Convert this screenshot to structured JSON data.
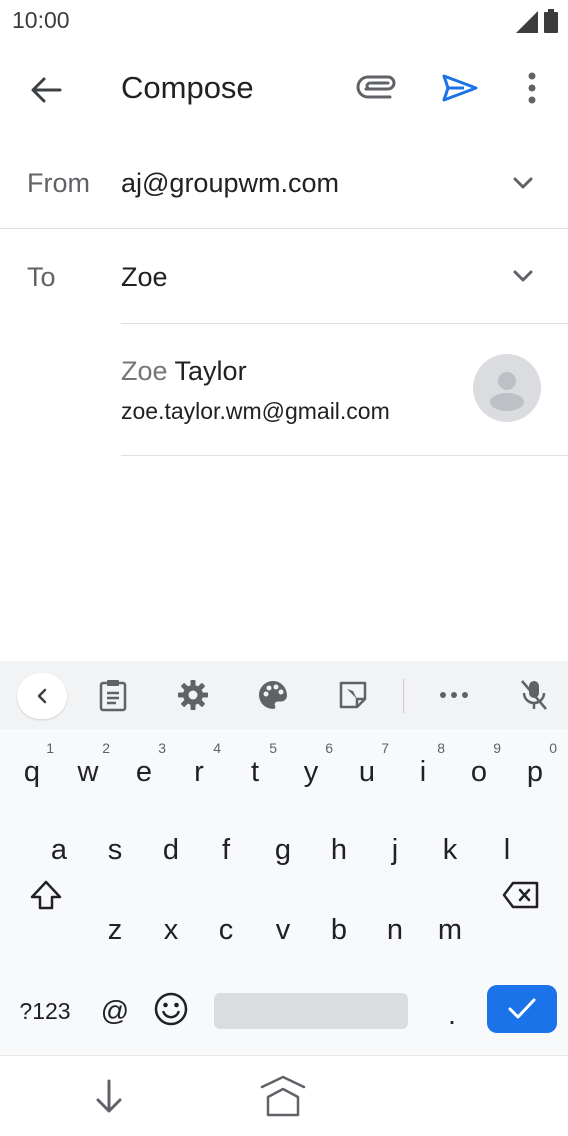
{
  "status": {
    "time": "10:00"
  },
  "appbar": {
    "title": "Compose"
  },
  "from": {
    "label": "From",
    "value": "aj@groupwm.com"
  },
  "to": {
    "label": "To",
    "value": "Zoe"
  },
  "suggestion": {
    "name_match": "Zoe",
    "name_rest": " Taylor",
    "email": "zoe.taylor.wm@gmail.com"
  },
  "keyboard": {
    "row1": [
      {
        "k": "q",
        "h": "1"
      },
      {
        "k": "w",
        "h": "2"
      },
      {
        "k": "e",
        "h": "3"
      },
      {
        "k": "r",
        "h": "4"
      },
      {
        "k": "t",
        "h": "5"
      },
      {
        "k": "y",
        "h": "6"
      },
      {
        "k": "u",
        "h": "7"
      },
      {
        "k": "i",
        "h": "8"
      },
      {
        "k": "o",
        "h": "9"
      },
      {
        "k": "p",
        "h": "0"
      }
    ],
    "row2": [
      "a",
      "s",
      "d",
      "f",
      "g",
      "h",
      "j",
      "k",
      "l"
    ],
    "row3": [
      "z",
      "x",
      "c",
      "v",
      "b",
      "n",
      "m"
    ],
    "symbols_label": "?123",
    "at_label": "@",
    "period_label": "."
  },
  "colors": {
    "accent": "#1a73e8",
    "keyboard_bg": "#f8f9fa",
    "toolbar_bg": "#f1f3f4"
  }
}
